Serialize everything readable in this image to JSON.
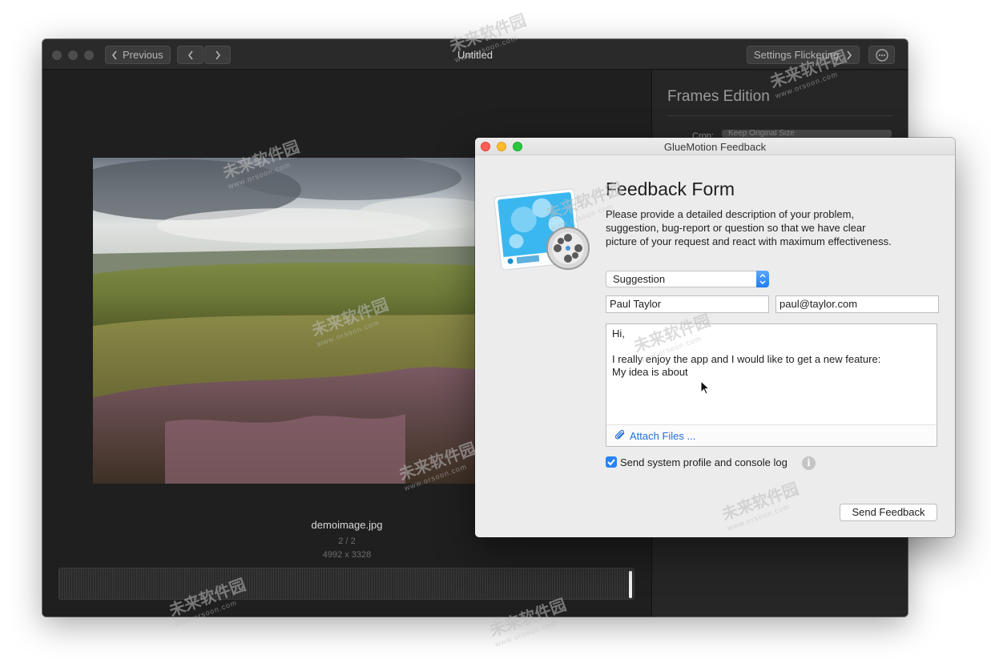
{
  "main_window": {
    "title": "Untitled",
    "previous_label": "Previous",
    "settings_label": "Settings Flickering",
    "side_panel": {
      "title": "Frames Edition",
      "crop_label": "Crop:",
      "crop_value": "Keep Original Size"
    },
    "image": {
      "filename": "demoimage.jpg",
      "counter": "2 / 2",
      "dimensions": "4992 x 3328"
    }
  },
  "feedback": {
    "window_title": "GlueMotion Feedback",
    "heading": "Feedback Form",
    "description": "Please provide a detailed description of your problem, suggestion, bug-report or question so that we have clear picture of your request and react with maximum effectiveness.",
    "type_selected": "Suggestion",
    "name_value": "Paul Taylor",
    "email_value": "paul@taylor.com",
    "message": "Hi,\n\nI really enjoy the app and I would like to get a new feature:\nMy idea is about ",
    "attach_label": "Attach Files ...",
    "checkbox_label": "Send system profile and console log",
    "checkbox_checked": true,
    "send_label": "Send Feedback"
  },
  "watermark": {
    "brand": "未来软件园",
    "url": "www.orsoon.com"
  },
  "colors": {
    "accent": "#2a82f5",
    "link": "#1f6fdc",
    "dark_bg": "#1f1f1f"
  }
}
